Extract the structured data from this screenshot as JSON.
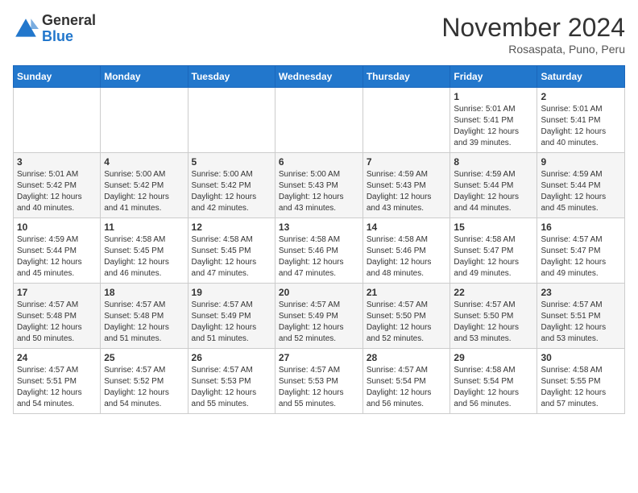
{
  "logo": {
    "general": "General",
    "blue": "Blue"
  },
  "header": {
    "month": "November 2024",
    "location": "Rosaspata, Puno, Peru"
  },
  "weekdays": [
    "Sunday",
    "Monday",
    "Tuesday",
    "Wednesday",
    "Thursday",
    "Friday",
    "Saturday"
  ],
  "weeks": [
    [
      {
        "day": "",
        "info": ""
      },
      {
        "day": "",
        "info": ""
      },
      {
        "day": "",
        "info": ""
      },
      {
        "day": "",
        "info": ""
      },
      {
        "day": "",
        "info": ""
      },
      {
        "day": "1",
        "info": "Sunrise: 5:01 AM\nSunset: 5:41 PM\nDaylight: 12 hours\nand 39 minutes."
      },
      {
        "day": "2",
        "info": "Sunrise: 5:01 AM\nSunset: 5:41 PM\nDaylight: 12 hours\nand 40 minutes."
      }
    ],
    [
      {
        "day": "3",
        "info": "Sunrise: 5:01 AM\nSunset: 5:42 PM\nDaylight: 12 hours\nand 40 minutes."
      },
      {
        "day": "4",
        "info": "Sunrise: 5:00 AM\nSunset: 5:42 PM\nDaylight: 12 hours\nand 41 minutes."
      },
      {
        "day": "5",
        "info": "Sunrise: 5:00 AM\nSunset: 5:42 PM\nDaylight: 12 hours\nand 42 minutes."
      },
      {
        "day": "6",
        "info": "Sunrise: 5:00 AM\nSunset: 5:43 PM\nDaylight: 12 hours\nand 43 minutes."
      },
      {
        "day": "7",
        "info": "Sunrise: 4:59 AM\nSunset: 5:43 PM\nDaylight: 12 hours\nand 43 minutes."
      },
      {
        "day": "8",
        "info": "Sunrise: 4:59 AM\nSunset: 5:44 PM\nDaylight: 12 hours\nand 44 minutes."
      },
      {
        "day": "9",
        "info": "Sunrise: 4:59 AM\nSunset: 5:44 PM\nDaylight: 12 hours\nand 45 minutes."
      }
    ],
    [
      {
        "day": "10",
        "info": "Sunrise: 4:59 AM\nSunset: 5:44 PM\nDaylight: 12 hours\nand 45 minutes."
      },
      {
        "day": "11",
        "info": "Sunrise: 4:58 AM\nSunset: 5:45 PM\nDaylight: 12 hours\nand 46 minutes."
      },
      {
        "day": "12",
        "info": "Sunrise: 4:58 AM\nSunset: 5:45 PM\nDaylight: 12 hours\nand 47 minutes."
      },
      {
        "day": "13",
        "info": "Sunrise: 4:58 AM\nSunset: 5:46 PM\nDaylight: 12 hours\nand 47 minutes."
      },
      {
        "day": "14",
        "info": "Sunrise: 4:58 AM\nSunset: 5:46 PM\nDaylight: 12 hours\nand 48 minutes."
      },
      {
        "day": "15",
        "info": "Sunrise: 4:58 AM\nSunset: 5:47 PM\nDaylight: 12 hours\nand 49 minutes."
      },
      {
        "day": "16",
        "info": "Sunrise: 4:57 AM\nSunset: 5:47 PM\nDaylight: 12 hours\nand 49 minutes."
      }
    ],
    [
      {
        "day": "17",
        "info": "Sunrise: 4:57 AM\nSunset: 5:48 PM\nDaylight: 12 hours\nand 50 minutes."
      },
      {
        "day": "18",
        "info": "Sunrise: 4:57 AM\nSunset: 5:48 PM\nDaylight: 12 hours\nand 51 minutes."
      },
      {
        "day": "19",
        "info": "Sunrise: 4:57 AM\nSunset: 5:49 PM\nDaylight: 12 hours\nand 51 minutes."
      },
      {
        "day": "20",
        "info": "Sunrise: 4:57 AM\nSunset: 5:49 PM\nDaylight: 12 hours\nand 52 minutes."
      },
      {
        "day": "21",
        "info": "Sunrise: 4:57 AM\nSunset: 5:50 PM\nDaylight: 12 hours\nand 52 minutes."
      },
      {
        "day": "22",
        "info": "Sunrise: 4:57 AM\nSunset: 5:50 PM\nDaylight: 12 hours\nand 53 minutes."
      },
      {
        "day": "23",
        "info": "Sunrise: 4:57 AM\nSunset: 5:51 PM\nDaylight: 12 hours\nand 53 minutes."
      }
    ],
    [
      {
        "day": "24",
        "info": "Sunrise: 4:57 AM\nSunset: 5:51 PM\nDaylight: 12 hours\nand 54 minutes."
      },
      {
        "day": "25",
        "info": "Sunrise: 4:57 AM\nSunset: 5:52 PM\nDaylight: 12 hours\nand 54 minutes."
      },
      {
        "day": "26",
        "info": "Sunrise: 4:57 AM\nSunset: 5:53 PM\nDaylight: 12 hours\nand 55 minutes."
      },
      {
        "day": "27",
        "info": "Sunrise: 4:57 AM\nSunset: 5:53 PM\nDaylight: 12 hours\nand 55 minutes."
      },
      {
        "day": "28",
        "info": "Sunrise: 4:57 AM\nSunset: 5:54 PM\nDaylight: 12 hours\nand 56 minutes."
      },
      {
        "day": "29",
        "info": "Sunrise: 4:58 AM\nSunset: 5:54 PM\nDaylight: 12 hours\nand 56 minutes."
      },
      {
        "day": "30",
        "info": "Sunrise: 4:58 AM\nSunset: 5:55 PM\nDaylight: 12 hours\nand 57 minutes."
      }
    ]
  ]
}
